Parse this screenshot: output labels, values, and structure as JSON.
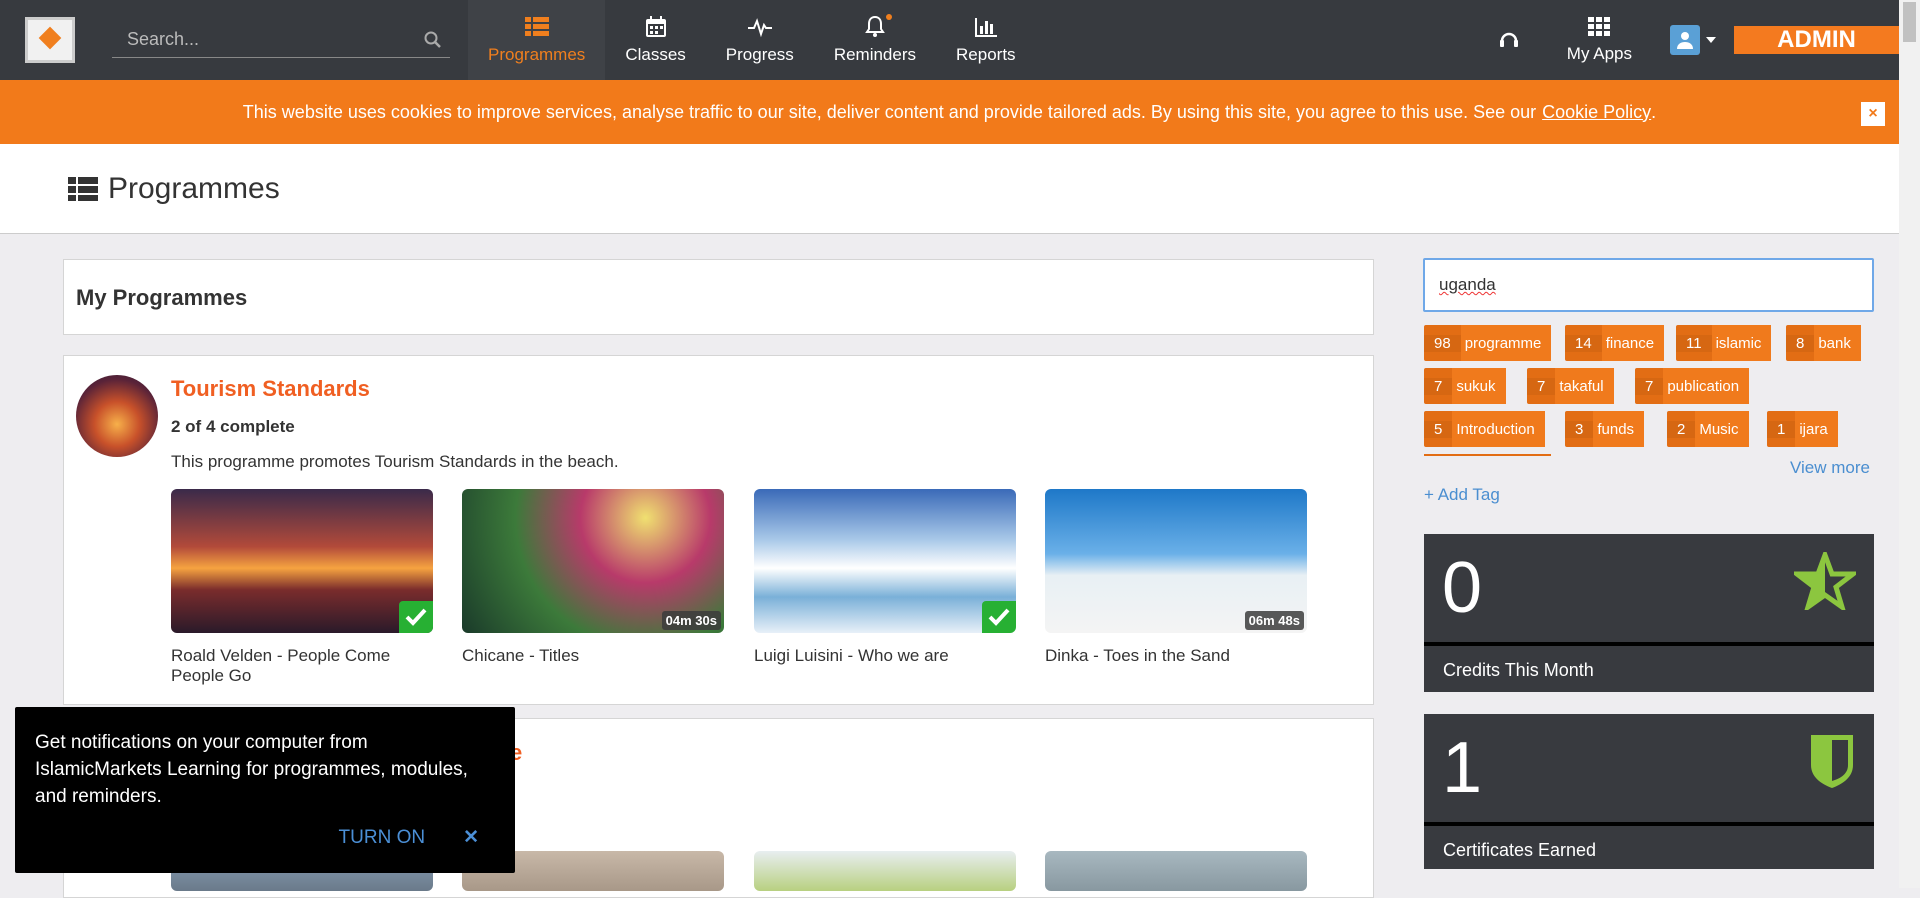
{
  "topbar": {
    "search_placeholder": "Search...",
    "nav": [
      {
        "label": "Programmes",
        "icon": "list-icon",
        "active": true
      },
      {
        "label": "Classes",
        "icon": "calendar-icon"
      },
      {
        "label": "Progress",
        "icon": "pulse-icon"
      },
      {
        "label": "Reminders",
        "icon": "bell-icon"
      },
      {
        "label": "Reports",
        "icon": "bar-chart-icon"
      }
    ],
    "myapps_label": "My Apps",
    "admin_label": "ADMIN"
  },
  "cookie": {
    "text": "This website uses cookies to improve services, analyse traffic to our site, deliver content and provide tailored ads. By using this site, you agree to this use. See our",
    "link": "Cookie Policy",
    "end": ".",
    "close": "×"
  },
  "page": {
    "title": "Programmes"
  },
  "my_programmes": {
    "title": "My Programmes"
  },
  "programme": {
    "title": "Tourism Standards",
    "count": "2 of 4 complete",
    "description": "This programme promotes Tourism Standards in the beach.",
    "modules": [
      {
        "caption": "Roald Velden - People Come People Go",
        "duration": "",
        "done": true
      },
      {
        "caption": "Chicane - Titles",
        "duration": "04m 30s",
        "done": false
      },
      {
        "caption": "Luigi Luisini - Who we are",
        "duration": "",
        "done": true
      },
      {
        "caption": "Dinka - Toes in the Sand",
        "duration": "06m 48s",
        "done": false
      }
    ]
  },
  "second_programme": {
    "title_visible": "e"
  },
  "sidebar": {
    "tag_input_value": "uganda",
    "tags": [
      {
        "count": "98",
        "label": "programme"
      },
      {
        "count": "14",
        "label": "finance"
      },
      {
        "count": "11",
        "label": "islamic"
      },
      {
        "count": "8",
        "label": "bank"
      },
      {
        "count": "7",
        "label": "sukuk"
      },
      {
        "count": "7",
        "label": "takaful"
      },
      {
        "count": "7",
        "label": "publication"
      },
      {
        "count": "5",
        "label": "Introduction"
      },
      {
        "count": "3",
        "label": "funds"
      },
      {
        "count": "2",
        "label": "Music"
      },
      {
        "count": "1",
        "label": "ijara"
      }
    ],
    "view_more": "View more",
    "add_tag": "+ Add Tag",
    "stats": [
      {
        "value": "0",
        "label": "Credits This Month",
        "icon": "star-icon",
        "color": "#8cc63f"
      },
      {
        "value": "1",
        "label": "Certificates Earned",
        "icon": "shield-icon",
        "color": "#8cc63f"
      }
    ]
  },
  "notification": {
    "text": "Get notifications on your computer from IslamicMarkets Learning for programmes, modules, and reminders.",
    "turn_on": "TURN ON",
    "close": "✕"
  }
}
